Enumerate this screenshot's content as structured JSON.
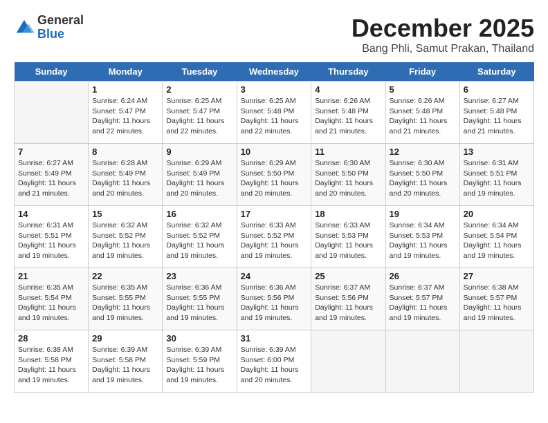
{
  "app": {
    "name_general": "General",
    "name_blue": "Blue"
  },
  "header": {
    "month_year": "December 2025",
    "location": "Bang Phli, Samut Prakan, Thailand"
  },
  "weekdays": [
    "Sunday",
    "Monday",
    "Tuesday",
    "Wednesday",
    "Thursday",
    "Friday",
    "Saturday"
  ],
  "weeks": [
    [
      {
        "day": "",
        "sunrise": "",
        "sunset": "",
        "daylight": ""
      },
      {
        "day": "1",
        "sunrise": "Sunrise: 6:24 AM",
        "sunset": "Sunset: 5:47 PM",
        "daylight": "Daylight: 11 hours and 22 minutes."
      },
      {
        "day": "2",
        "sunrise": "Sunrise: 6:25 AM",
        "sunset": "Sunset: 5:47 PM",
        "daylight": "Daylight: 11 hours and 22 minutes."
      },
      {
        "day": "3",
        "sunrise": "Sunrise: 6:25 AM",
        "sunset": "Sunset: 5:48 PM",
        "daylight": "Daylight: 11 hours and 22 minutes."
      },
      {
        "day": "4",
        "sunrise": "Sunrise: 6:26 AM",
        "sunset": "Sunset: 5:48 PM",
        "daylight": "Daylight: 11 hours and 21 minutes."
      },
      {
        "day": "5",
        "sunrise": "Sunrise: 6:26 AM",
        "sunset": "Sunset: 5:48 PM",
        "daylight": "Daylight: 11 hours and 21 minutes."
      },
      {
        "day": "6",
        "sunrise": "Sunrise: 6:27 AM",
        "sunset": "Sunset: 5:48 PM",
        "daylight": "Daylight: 11 hours and 21 minutes."
      }
    ],
    [
      {
        "day": "7",
        "sunrise": "Sunrise: 6:27 AM",
        "sunset": "Sunset: 5:49 PM",
        "daylight": "Daylight: 11 hours and 21 minutes."
      },
      {
        "day": "8",
        "sunrise": "Sunrise: 6:28 AM",
        "sunset": "Sunset: 5:49 PM",
        "daylight": "Daylight: 11 hours and 20 minutes."
      },
      {
        "day": "9",
        "sunrise": "Sunrise: 6:29 AM",
        "sunset": "Sunset: 5:49 PM",
        "daylight": "Daylight: 11 hours and 20 minutes."
      },
      {
        "day": "10",
        "sunrise": "Sunrise: 6:29 AM",
        "sunset": "Sunset: 5:50 PM",
        "daylight": "Daylight: 11 hours and 20 minutes."
      },
      {
        "day": "11",
        "sunrise": "Sunrise: 6:30 AM",
        "sunset": "Sunset: 5:50 PM",
        "daylight": "Daylight: 11 hours and 20 minutes."
      },
      {
        "day": "12",
        "sunrise": "Sunrise: 6:30 AM",
        "sunset": "Sunset: 5:50 PM",
        "daylight": "Daylight: 11 hours and 20 minutes."
      },
      {
        "day": "13",
        "sunrise": "Sunrise: 6:31 AM",
        "sunset": "Sunset: 5:51 PM",
        "daylight": "Daylight: 11 hours and 19 minutes."
      }
    ],
    [
      {
        "day": "14",
        "sunrise": "Sunrise: 6:31 AM",
        "sunset": "Sunset: 5:51 PM",
        "daylight": "Daylight: 11 hours and 19 minutes."
      },
      {
        "day": "15",
        "sunrise": "Sunrise: 6:32 AM",
        "sunset": "Sunset: 5:52 PM",
        "daylight": "Daylight: 11 hours and 19 minutes."
      },
      {
        "day": "16",
        "sunrise": "Sunrise: 6:32 AM",
        "sunset": "Sunset: 5:52 PM",
        "daylight": "Daylight: 11 hours and 19 minutes."
      },
      {
        "day": "17",
        "sunrise": "Sunrise: 6:33 AM",
        "sunset": "Sunset: 5:52 PM",
        "daylight": "Daylight: 11 hours and 19 minutes."
      },
      {
        "day": "18",
        "sunrise": "Sunrise: 6:33 AM",
        "sunset": "Sunset: 5:53 PM",
        "daylight": "Daylight: 11 hours and 19 minutes."
      },
      {
        "day": "19",
        "sunrise": "Sunrise: 6:34 AM",
        "sunset": "Sunset: 5:53 PM",
        "daylight": "Daylight: 11 hours and 19 minutes."
      },
      {
        "day": "20",
        "sunrise": "Sunrise: 6:34 AM",
        "sunset": "Sunset: 5:54 PM",
        "daylight": "Daylight: 11 hours and 19 minutes."
      }
    ],
    [
      {
        "day": "21",
        "sunrise": "Sunrise: 6:35 AM",
        "sunset": "Sunset: 5:54 PM",
        "daylight": "Daylight: 11 hours and 19 minutes."
      },
      {
        "day": "22",
        "sunrise": "Sunrise: 6:35 AM",
        "sunset": "Sunset: 5:55 PM",
        "daylight": "Daylight: 11 hours and 19 minutes."
      },
      {
        "day": "23",
        "sunrise": "Sunrise: 6:36 AM",
        "sunset": "Sunset: 5:55 PM",
        "daylight": "Daylight: 11 hours and 19 minutes."
      },
      {
        "day": "24",
        "sunrise": "Sunrise: 6:36 AM",
        "sunset": "Sunset: 5:56 PM",
        "daylight": "Daylight: 11 hours and 19 minutes."
      },
      {
        "day": "25",
        "sunrise": "Sunrise: 6:37 AM",
        "sunset": "Sunset: 5:56 PM",
        "daylight": "Daylight: 11 hours and 19 minutes."
      },
      {
        "day": "26",
        "sunrise": "Sunrise: 6:37 AM",
        "sunset": "Sunset: 5:57 PM",
        "daylight": "Daylight: 11 hours and 19 minutes."
      },
      {
        "day": "27",
        "sunrise": "Sunrise: 6:38 AM",
        "sunset": "Sunset: 5:57 PM",
        "daylight": "Daylight: 11 hours and 19 minutes."
      }
    ],
    [
      {
        "day": "28",
        "sunrise": "Sunrise: 6:38 AM",
        "sunset": "Sunset: 5:58 PM",
        "daylight": "Daylight: 11 hours and 19 minutes."
      },
      {
        "day": "29",
        "sunrise": "Sunrise: 6:39 AM",
        "sunset": "Sunset: 5:58 PM",
        "daylight": "Daylight: 11 hours and 19 minutes."
      },
      {
        "day": "30",
        "sunrise": "Sunrise: 6:39 AM",
        "sunset": "Sunset: 5:59 PM",
        "daylight": "Daylight: 11 hours and 19 minutes."
      },
      {
        "day": "31",
        "sunrise": "Sunrise: 6:39 AM",
        "sunset": "Sunset: 6:00 PM",
        "daylight": "Daylight: 11 hours and 20 minutes."
      },
      {
        "day": "",
        "sunrise": "",
        "sunset": "",
        "daylight": ""
      },
      {
        "day": "",
        "sunrise": "",
        "sunset": "",
        "daylight": ""
      },
      {
        "day": "",
        "sunrise": "",
        "sunset": "",
        "daylight": ""
      }
    ]
  ]
}
